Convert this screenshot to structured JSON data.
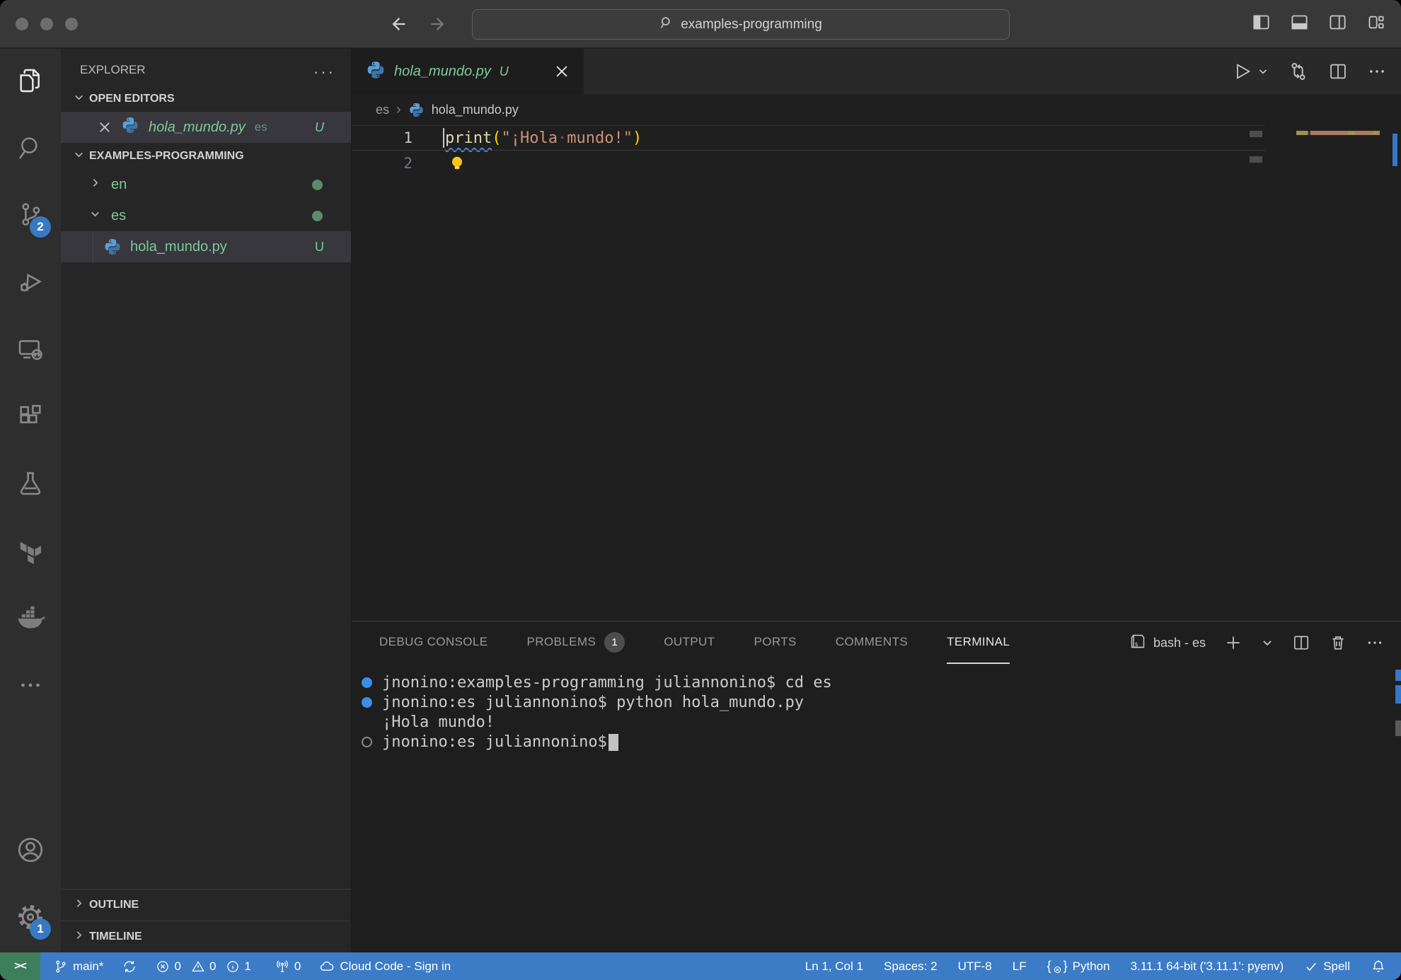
{
  "titlebar": {
    "search": "examples-programming"
  },
  "activity_bar": {
    "scm_badge": "2",
    "settings_badge": "1"
  },
  "sidebar": {
    "title": "EXPLORER",
    "open_editors_label": "OPEN EDITORS",
    "open_editor": {
      "file": "hola_mundo.py",
      "folder": "es",
      "badge": "U"
    },
    "workspace_label": "EXAMPLES-PROGRAMMING",
    "tree": [
      {
        "label": "en"
      },
      {
        "label": "es"
      },
      {
        "label": "hola_mundo.py",
        "badge": "U"
      }
    ],
    "outline_label": "OUTLINE",
    "timeline_label": "TIMELINE"
  },
  "editor": {
    "tab": {
      "file": "hola_mundo.py",
      "badge": "U"
    },
    "breadcrumb": {
      "folder": "es",
      "file": "hola_mundo.py"
    },
    "line_numbers": [
      "1",
      "2"
    ],
    "code": {
      "fn": "print",
      "open": "(",
      "str1": "\"¡Hola",
      "ws": "·",
      "str2": "mundo!\"",
      "close": ")"
    }
  },
  "panel": {
    "tabs": [
      "DEBUG CONSOLE",
      "PROBLEMS",
      "OUTPUT",
      "PORTS",
      "COMMENTS",
      "TERMINAL"
    ],
    "problems_badge": "1",
    "terminal_session": "bash - es",
    "terminal_lines": [
      {
        "text": "jnonino:examples-programming juliannonino$ cd es"
      },
      {
        "text": "jnonino:es juliannonino$ python hola_mundo.py"
      },
      {
        "text": "¡Hola mundo!"
      },
      {
        "text": "jnonino:es juliannonino$"
      }
    ]
  },
  "status_bar": {
    "remote": "><",
    "branch": "main*",
    "errors": "0",
    "warnings": "0",
    "infos": "1",
    "ports": "0",
    "cloud": "Cloud Code - Sign in",
    "cursor": "Ln 1, Col 1",
    "indent": "Spaces: 2",
    "encoding": "UTF-8",
    "eol": "LF",
    "language": "Python",
    "interpreter": "3.11.1 64-bit ('3.11.1': pyenv)",
    "spell": "Spell"
  },
  "colors": {
    "statusbar_blue": "#3c7bc5",
    "remote_green": "#3d7e5b",
    "badge_blue": "#3779c2",
    "untracked_green": "#7fc99a",
    "string_token": "#ce9178",
    "function_token": "#dcdcaa",
    "bracket_token": "#ffd700",
    "terminal_marker_blue": "#3b8eea"
  }
}
